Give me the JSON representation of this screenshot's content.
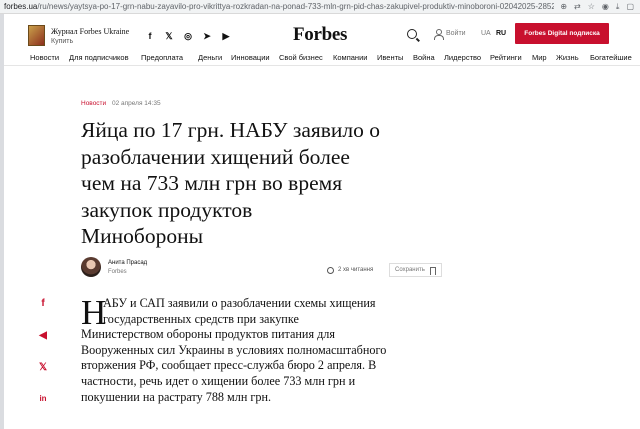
{
  "browser": {
    "url_host": "forbes.ua",
    "url_path": "/ru/news/yaytsya-po-17-grn-nabu-zayavilo-pro-vikrittya-rozkradan-na-ponad-733-mln-grn-pid-chas-zakupivel-produktiv-minoboroni-02042025-2852"
  },
  "header": {
    "magazine_title": "Журнал Forbes Ukraine",
    "magazine_buy": "Купить",
    "social": [
      {
        "icon": "facebook-icon",
        "glyph": "f"
      },
      {
        "icon": "twitter-icon",
        "glyph": "𝕏"
      },
      {
        "icon": "instagram-icon",
        "glyph": "◎"
      },
      {
        "icon": "telegram-icon",
        "glyph": "➤"
      },
      {
        "icon": "youtube-icon",
        "glyph": "▶"
      }
    ],
    "brand": "Forbes",
    "login": "Войти",
    "lang_ua": "UA",
    "lang_ru": "RU",
    "subscribe": "Forbes Digital подписка"
  },
  "nav": [
    "Новости",
    "Для подписчиков",
    "Предоплата",
    "Деньги",
    "Инновации",
    "Свой бизнес",
    "Компании",
    "Ивенты",
    "Война",
    "Лидерство",
    "Рейтинги",
    "Мир",
    "Жизнь",
    "Богатейшие"
  ],
  "article": {
    "category": "Новости",
    "date": "02 апреля 14:35",
    "headline_lines": [
      "Яйца по 17 грн. НАБУ заявило о",
      "разоблачении хищений более",
      "чем на 733 млн грн во время",
      "закупок продуктов",
      "Минобороны"
    ],
    "author_name": "Анита Прасад",
    "author_org": "Forbes",
    "read_time": "2 хв читання",
    "save_label": "Сохранить",
    "dropcap": "Н",
    "lead_lines": [
      "АБУ и САП заявили о разоблачении схемы хищения",
      "государственных средств при закупке",
      "Министерством обороны продуктов питания для",
      "Вооруженных сил Украины в условиях полномасштабного",
      "вторжения РФ, сообщает пресс-служба бюро 2 апреля. В",
      "частности, речь идет о хищении более 733 млн грн и",
      "покушении на растрату 788 млн грн."
    ]
  },
  "share": [
    {
      "icon": "facebook-share-icon",
      "glyph": "f"
    },
    {
      "icon": "telegram-share-icon",
      "glyph": "◀"
    },
    {
      "icon": "twitter-share-icon",
      "glyph": "𝕏"
    },
    {
      "icon": "linkedin-share-icon",
      "glyph": "in"
    }
  ],
  "colors": {
    "accent": "#c8102e",
    "text": "#111111",
    "muted": "#777777"
  }
}
